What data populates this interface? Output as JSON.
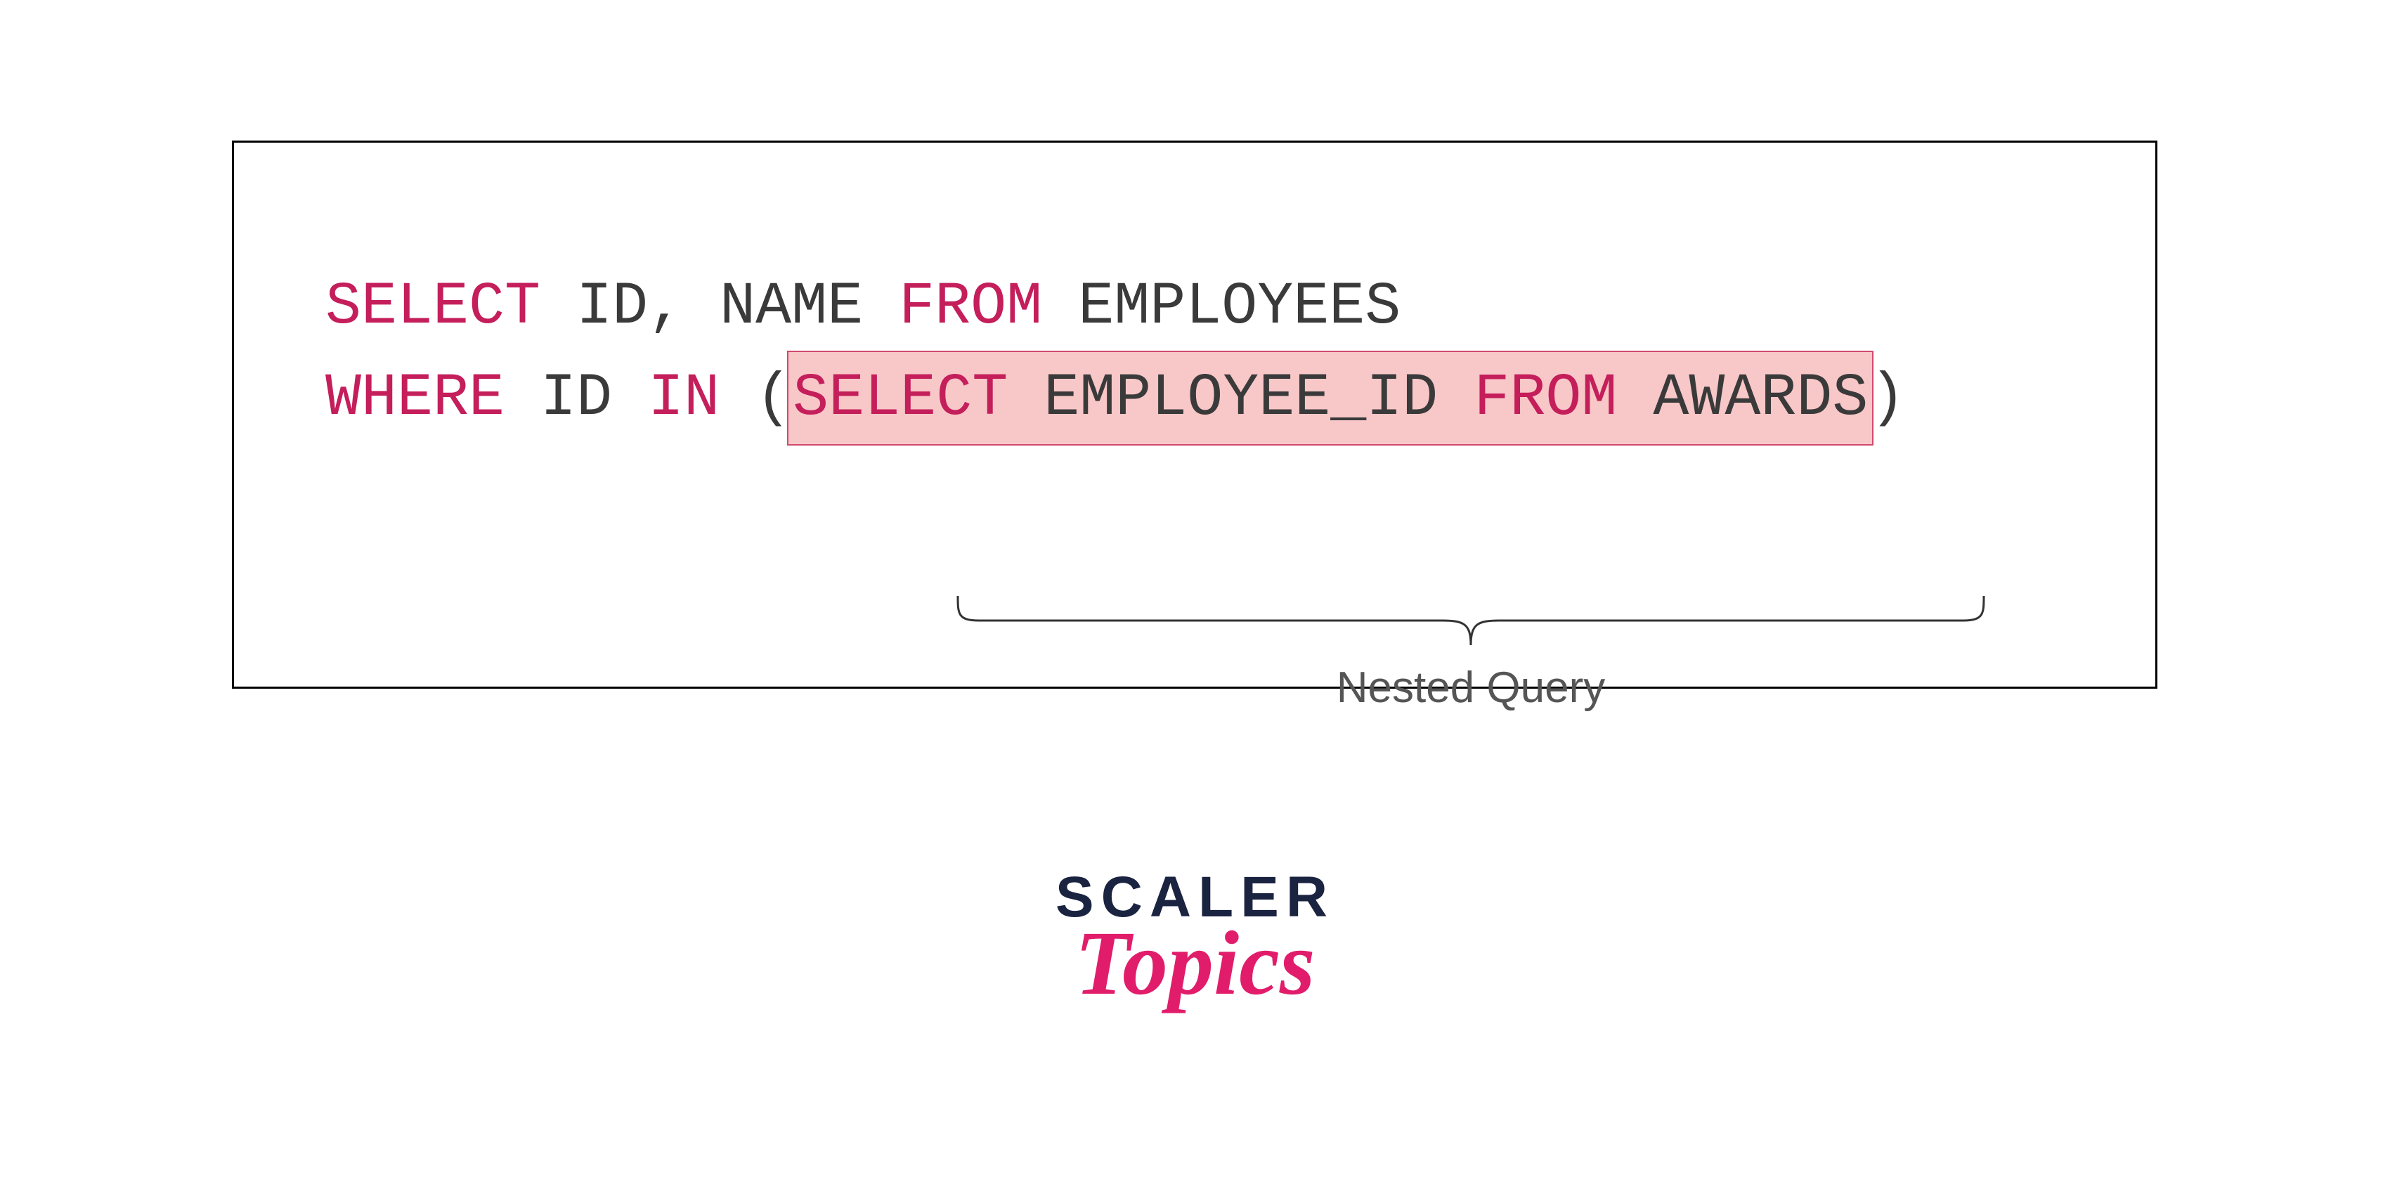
{
  "code": {
    "line1": {
      "select": "SELECT",
      "cols": " ID, NAME ",
      "from": "FROM",
      "table": " EMPLOYEES"
    },
    "line2": {
      "where": "WHERE",
      "cond": " ID ",
      "in": "IN",
      "lparen": " (",
      "nested": {
        "select": "SELECT",
        "col": " EMPLOYEE_ID ",
        "from": "FROM",
        "table": " AWARDS"
      },
      "rparen": ")"
    }
  },
  "annotation": "Nested Query",
  "logo": {
    "scaler": "SCALER",
    "topics": "Topics"
  }
}
